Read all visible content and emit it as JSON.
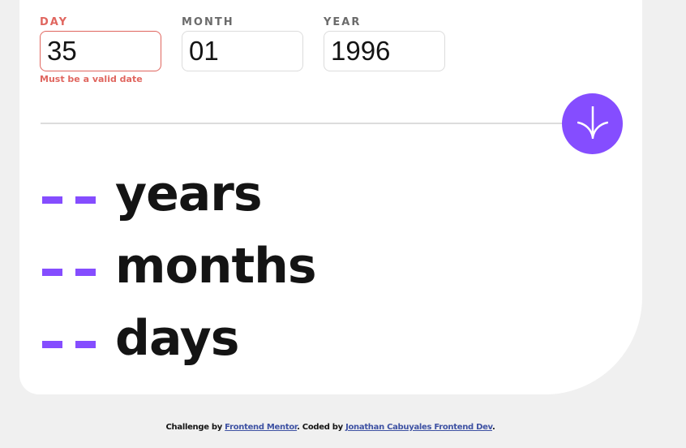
{
  "form": {
    "day": {
      "label": "DAY",
      "value": "35",
      "error": "Must be a valid date"
    },
    "month": {
      "label": "MONTH",
      "value": "01"
    },
    "year": {
      "label": "YEAR",
      "value": "1996"
    },
    "submit_icon": "arrow-down-icon"
  },
  "results": [
    {
      "value": "- -",
      "label": "years"
    },
    {
      "value": "- -",
      "label": "months"
    },
    {
      "value": "- -",
      "label": "days"
    }
  ],
  "footer": {
    "prefix": "Challenge by ",
    "mentor_link": "Frontend Mentor",
    "middle": ". Coded by ",
    "author_link": "Jonathan Cabuyales Frontend Dev",
    "suffix": "."
  },
  "colors": {
    "accent": "#854dff",
    "error": "#e0665f",
    "background": "#f0f0f0",
    "card": "#ffffff"
  }
}
